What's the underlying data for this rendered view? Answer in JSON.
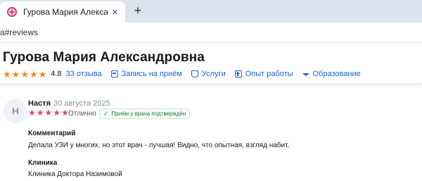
{
  "browser": {
    "tab_title": "Гурова Мария Александрова",
    "tab_close": "×",
    "new_tab": "+",
    "url": "a#reviews"
  },
  "doctor": {
    "name": "Гурова Мария Александровна",
    "rating_stars": 5,
    "rating": "4.8",
    "reviews_link": "33 отзыва",
    "nav": [
      {
        "label": "Запись на приём",
        "icon": "calendar-icon"
      },
      {
        "label": "Услуги",
        "icon": "tag-icon"
      },
      {
        "label": "Опыт работы",
        "icon": "plus-square-icon"
      },
      {
        "label": "Образование",
        "icon": "graduation-cap-icon"
      }
    ]
  },
  "review": {
    "avatar_letter": "Н",
    "author": "Настя",
    "date": "30 августа 2025",
    "stars": 5,
    "grade": "Отлично",
    "verified": "Приём у врача подтверждён",
    "comment_title": "Комментарий",
    "comment_text": "Делала УЗИ у многих, но этот врач - лучшая! Видно, что опытная, взгляд набит.",
    "clinic_title": "Клиника",
    "clinic_name": "Клиника Доктора Назимовой"
  },
  "colors": {
    "accent_link": "#1a64d6",
    "rating_star": "#f58220",
    "review_star": "#ea3d7c",
    "verified_green": "#1f7a3a"
  }
}
